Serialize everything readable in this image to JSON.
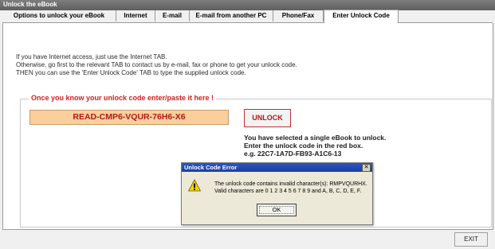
{
  "window": {
    "title": "Unlock the eBook",
    "accent": "#6b6b6b"
  },
  "tabs": [
    {
      "label": "Options to unlock your eBook",
      "active": false
    },
    {
      "label": "Internet",
      "active": false
    },
    {
      "label": "E-mail",
      "active": false
    },
    {
      "label": "E-mail from another PC",
      "active": false
    },
    {
      "label": "Phone/Fax",
      "active": false
    },
    {
      "label": "Enter Unlock Code",
      "active": true
    }
  ],
  "info": {
    "line1": "If you have Internet access, just use the Internet TAB.",
    "line2": "Otherwise, go first to the relevant TAB to contact us by e-mail, fax or phone to get your unlock code.",
    "line3": "THEN you can use the 'Enter Unlock Code' TAB to type the supplied unlock code."
  },
  "unlock_group": {
    "label": "Once you know your unlock code enter/paste it here !",
    "code_value": "READ-CMP6-VQUR-76H6-X6",
    "button_label": "UNLOCK",
    "help_line1": "You have selected a single eBook to unlock.",
    "help_line2": "Enter the unlock code in the red box.",
    "help_line3": "e.g. 22C7-1A7D-FB93-A1C6-13"
  },
  "error_dialog": {
    "title": "Unlock Code Error",
    "message_line1": "The unlock code contains invalid character(s): RMPVQURHX.",
    "message_line2": "Valid characters are 0 1 2 3 4 5 6 7 8 9 and A, B, C, D, E, F.",
    "ok_label": "OK",
    "close_glyph": "✕",
    "icon": "warning-icon"
  },
  "footer": {
    "exit_label": "EXIT"
  }
}
